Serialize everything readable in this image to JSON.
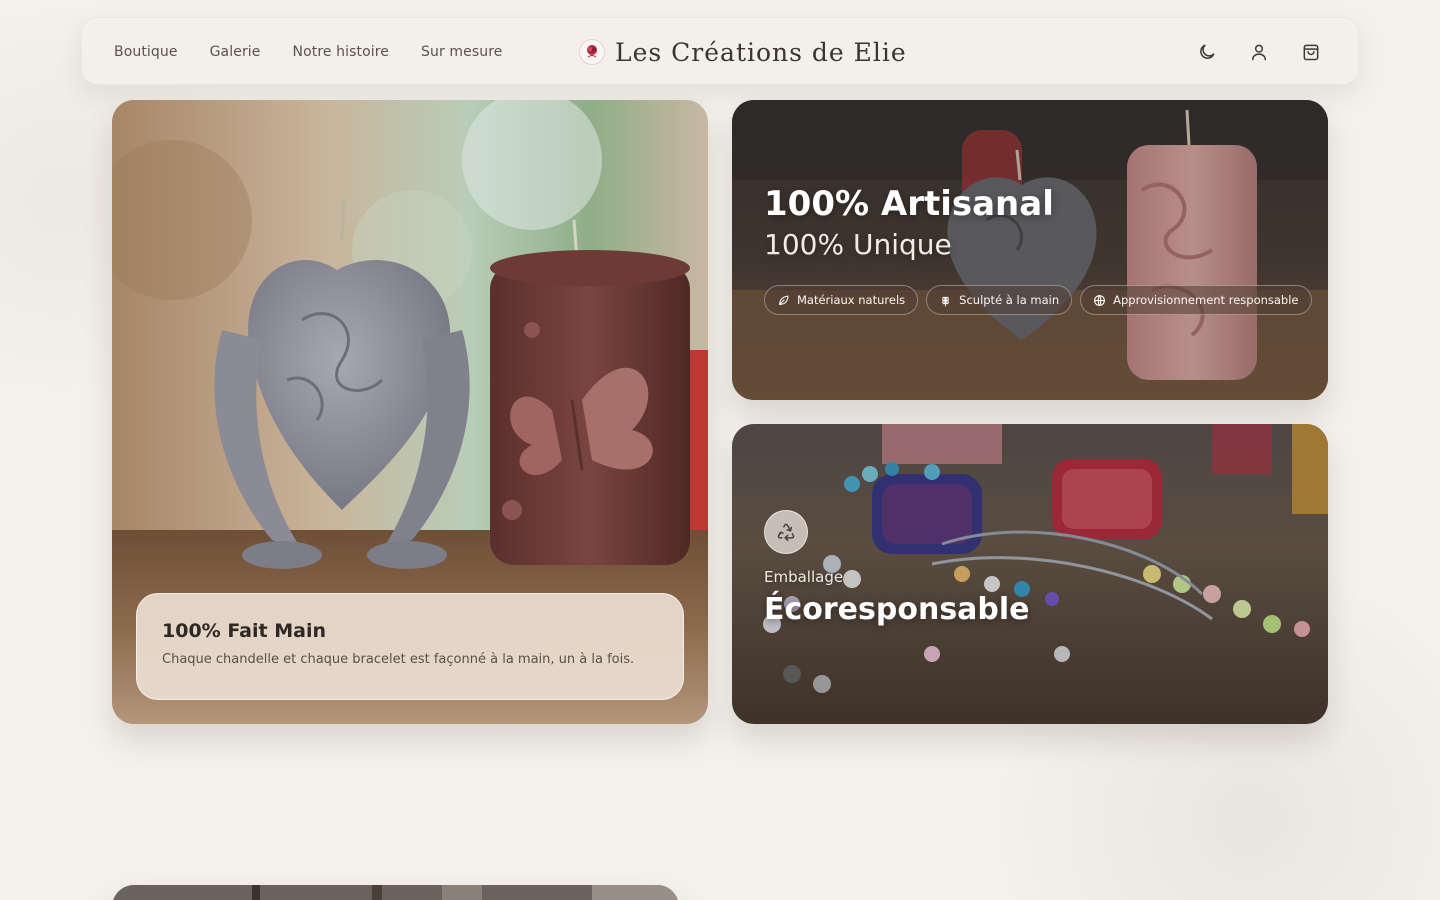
{
  "nav": {
    "links": [
      "Boutique",
      "Galerie",
      "Notre histoire",
      "Sur mesure"
    ],
    "brand": "Les Créations de Elie",
    "icons": [
      "moon-icon",
      "user-icon",
      "shopping-bag-icon"
    ]
  },
  "cards": {
    "handmade": {
      "title": "100% Fait Main",
      "text": "Chaque chandelle et chaque bracelet est façonné à la main, un à la fois."
    },
    "artisanal": {
      "title": "100% Artisanal",
      "subtitle": "100% Unique",
      "badges": [
        {
          "icon": "leaf-icon",
          "label": "Matériaux naturels"
        },
        {
          "icon": "wheat-icon",
          "label": "Sculpté à la main"
        },
        {
          "icon": "globe-icon",
          "label": "Approvisionnement responsable"
        }
      ]
    },
    "packaging": {
      "icon": "recycle-icon",
      "kicker": "Emballage",
      "title": "Écoresponsable"
    }
  },
  "colors": {
    "background": "#f4f1ec",
    "nav_bg": "#f3f0eb",
    "text_dark": "#3a3430",
    "candle_grey": "#8e8f99",
    "candle_burgundy": "#6b3a36",
    "candle_pink": "#d9a3a0"
  }
}
